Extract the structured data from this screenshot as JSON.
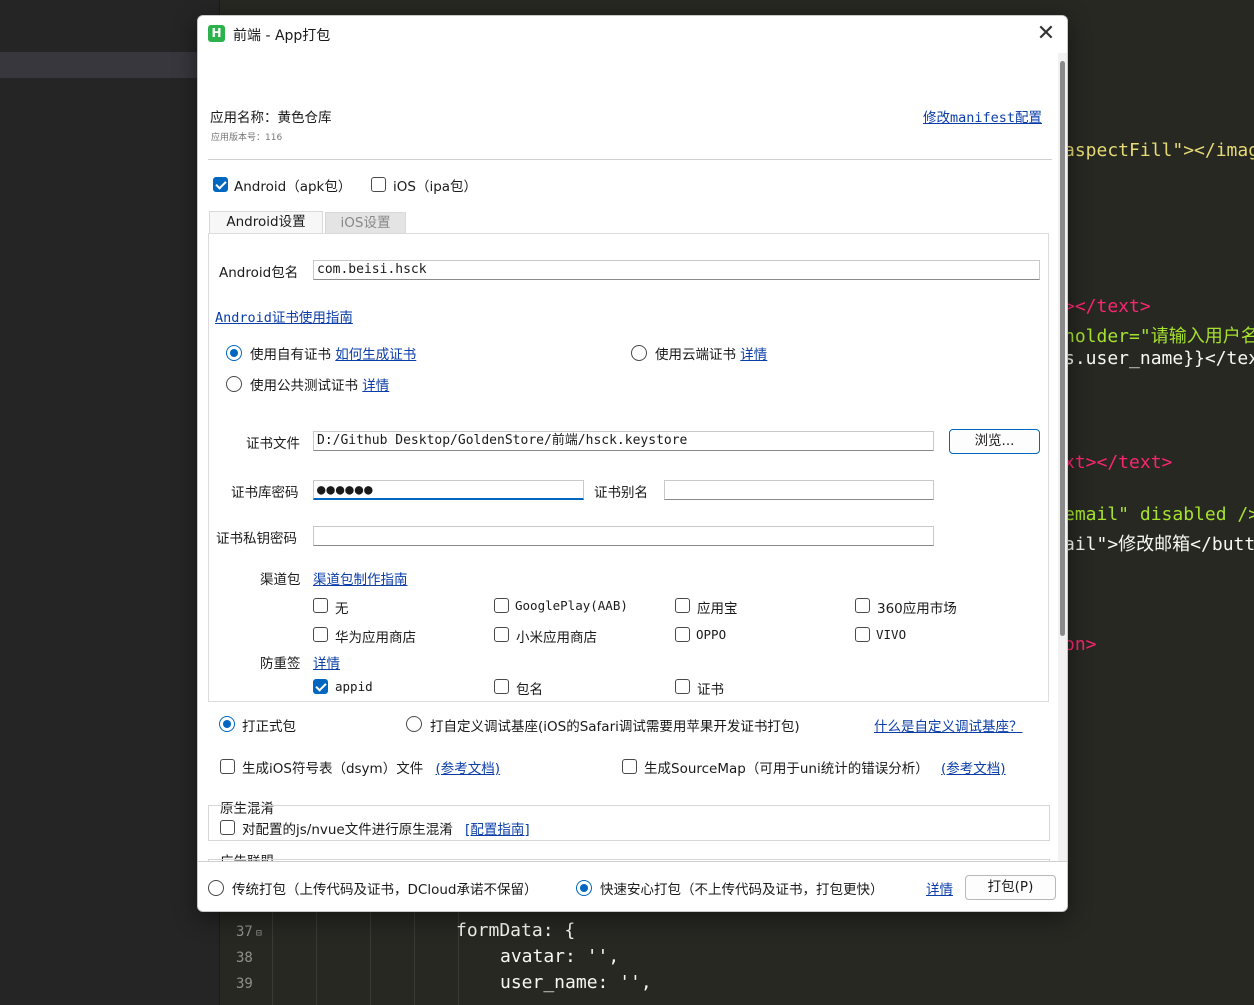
{
  "window": {
    "title": "前端 - App打包",
    "logo": "H",
    "close_glyph": "✕"
  },
  "app_info": {
    "name_label": "应用名称：黄色仓库",
    "version_label": "应用版本号：116",
    "manifest_link": "修改manifest配置"
  },
  "platforms": {
    "android": {
      "label": "Android（apk包）",
      "checked": true
    },
    "ios": {
      "label": "iOS（ipa包）",
      "checked": false
    }
  },
  "tabs": [
    {
      "label": "Android设置",
      "active": true
    },
    {
      "label": "iOS设置",
      "active": false
    }
  ],
  "android": {
    "package_label": "Android包名",
    "package_value": "com.beisi.hsck",
    "cert_guide_link": "Android证书使用指南",
    "cert_options": {
      "own": {
        "label": "使用自有证书",
        "link": "如何生成证书",
        "selected": true
      },
      "cloud": {
        "label": "使用云端证书",
        "link": "详情",
        "selected": false
      },
      "public_test": {
        "label": "使用公共测试证书",
        "link": "详情",
        "selected": false
      }
    },
    "cert_file_label": "证书文件",
    "cert_file_value": "D:/Github Desktop/GoldenStore/前端/hsck.keystore",
    "browse_button": "浏览...",
    "keystore_password_label": "证书库密码",
    "keystore_password_value": "●●●●●●",
    "alias_label": "证书别名",
    "alias_value": "",
    "private_key_password_label": "证书私钥密码",
    "private_key_password_value": "",
    "channel_label": "渠道包",
    "channel_guide_link": "渠道包制作指南",
    "channels": [
      {
        "label": "无",
        "checked": false
      },
      {
        "label": "GooglePlay(AAB)",
        "checked": false
      },
      {
        "label": "应用宝",
        "checked": false
      },
      {
        "label": "360应用市场",
        "checked": false
      },
      {
        "label": "华为应用商店",
        "checked": false
      },
      {
        "label": "小米应用商店",
        "checked": false
      },
      {
        "label": "OPPO",
        "checked": false
      },
      {
        "label": "VIVO",
        "checked": false
      }
    ],
    "anti_resign_label": "防重签",
    "anti_resign_link": "详情",
    "anti_resign_options": [
      {
        "label": "appid",
        "checked": true
      },
      {
        "label": "包名",
        "checked": false
      },
      {
        "label": "证书",
        "checked": false
      }
    ]
  },
  "build_type": {
    "release": {
      "label": "打正式包",
      "selected": true
    },
    "custom_base": {
      "label": "打自定义调试基座(iOS的Safari调试需要用苹果开发证书打包)",
      "selected": false
    },
    "custom_base_help_link": "什么是自定义调试基座？"
  },
  "extras": {
    "dsym": {
      "label": "生成iOS符号表（dsym）文件",
      "link": "(参考文档)",
      "checked": false
    },
    "sourcemap": {
      "label": "生成SourceMap（可用于uni统计的错误分析）",
      "link": "(参考文档)",
      "checked": false
    }
  },
  "obfuscation": {
    "section_title": "原生混淆",
    "option_label": "对配置的js/nvue文件进行原生混淆",
    "guide_link": "[配置指南]",
    "checked": false
  },
  "ads": {
    "section_title": "广告联盟"
  },
  "footer": {
    "traditional": {
      "label": "传统打包（上传代码及证书，DCloud承诺不保留）",
      "selected": false
    },
    "fast_safe": {
      "label": "快速安心打包（不上传代码及证书，打包更快）",
      "selected": true
    },
    "details_link": "详情",
    "pack_button": "打包(P)"
  },
  "editor_bg": {
    "lines_right": [
      "aspectFill\"></imag",
      "></text>",
      "holder=\"请输入用户名",
      "s.user_name}}</tex",
      "xt></text>",
      "email\" disabled />",
      "ail\">修改邮箱</butt",
      "on>"
    ],
    "line_numbers": [
      "37",
      "38",
      "39"
    ],
    "lines_bottom": [
      "formData: {",
      "avatar: '',",
      "user_name: '',"
    ]
  }
}
